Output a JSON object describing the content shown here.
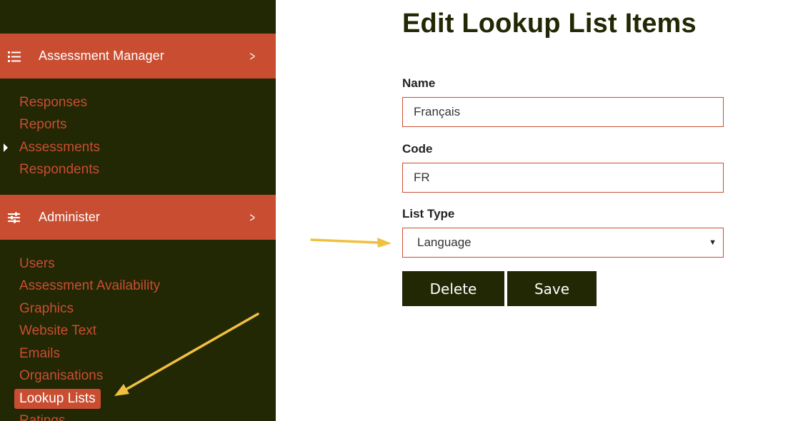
{
  "sidebar": {
    "sections": [
      {
        "title": "Assessment Manager",
        "icon": "list-icon",
        "items": [
          {
            "label": "Responses"
          },
          {
            "label": "Reports"
          },
          {
            "label": "Assessments"
          },
          {
            "label": "Respondents"
          }
        ]
      },
      {
        "title": "Administer",
        "icon": "sliders-icon",
        "items": [
          {
            "label": "Users"
          },
          {
            "label": "Assessment Availability"
          },
          {
            "label": "Graphics"
          },
          {
            "label": "Website Text"
          },
          {
            "label": "Emails"
          },
          {
            "label": "Organisations"
          },
          {
            "label": "Lookup Lists"
          },
          {
            "label": "Ratings"
          }
        ]
      }
    ]
  },
  "form": {
    "title": "Edit Lookup List Items",
    "name_label": "Name",
    "name_value": "Français",
    "code_label": "Code",
    "code_value": "FR",
    "list_type_label": "List Type",
    "list_type_value": "Language",
    "delete_label": "Delete",
    "save_label": "Save"
  },
  "colors": {
    "sidebar_bg": "#222704",
    "accent": "#c94e31",
    "annotation_arrow": "#f0c040"
  }
}
